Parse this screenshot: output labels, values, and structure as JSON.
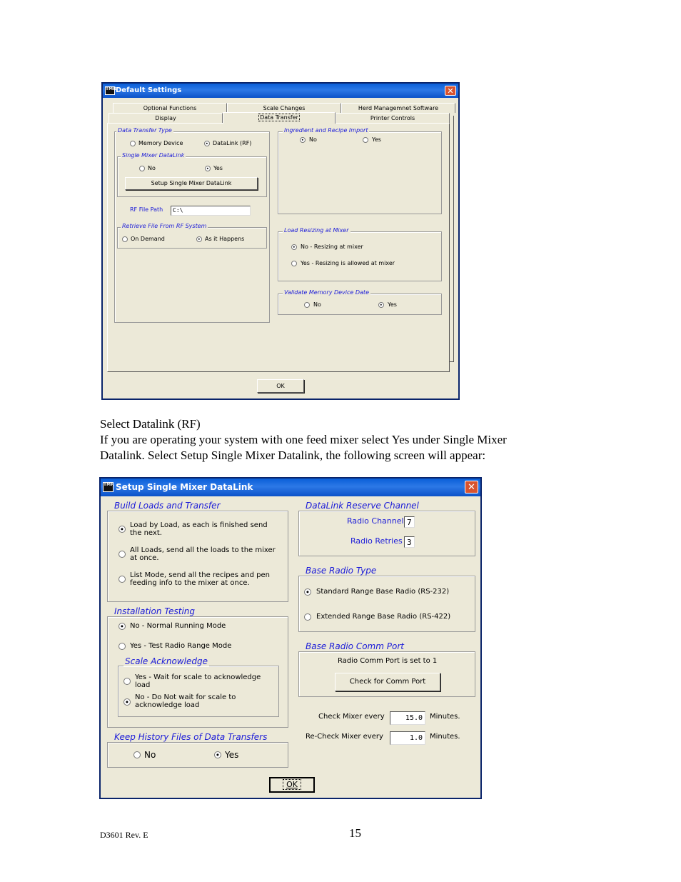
{
  "dialog1": {
    "title": "Default Settings",
    "title_icon": "TMR",
    "tabs_row1": [
      "Optional Functions",
      "Scale Changes",
      "Herd Managemnet Software"
    ],
    "tabs_row2": [
      "Display",
      "Data Transfer",
      "Printer Controls"
    ],
    "data_transfer_type": {
      "title": "Data Transfer Type",
      "options": [
        "Memory Device",
        "DataLink (RF)"
      ],
      "selected": "DataLink (RF)"
    },
    "single_mixer_datalink": {
      "title": "Single Mixer DataLink",
      "options": [
        "No",
        "Yes"
      ],
      "selected": "Yes",
      "setup_button": "Setup Single Mixer DataLink"
    },
    "rf_file_path": {
      "label": "RF File Path",
      "value": "C:\\"
    },
    "retrieve_file": {
      "title": "Retrieve File From RF System",
      "options": [
        "On Demand",
        "As it Happens"
      ],
      "selected": "As it Happens"
    },
    "ingredient_recipe_import": {
      "title": "Ingredient and Recipe Import",
      "options": [
        "No",
        "Yes"
      ],
      "selected": "No"
    },
    "load_resizing": {
      "title": "Load Resizing at Mixer",
      "options": [
        "No  - Resizing at mixer",
        "Yes -  Resizing is allowed at mixer"
      ],
      "selected": "No  - Resizing at mixer"
    },
    "validate_date": {
      "title": "Validate Memory Device Date",
      "options": [
        "No",
        "Yes"
      ],
      "selected": "Yes"
    },
    "ok_button": "OK"
  },
  "body_text": {
    "line1": "Select Datalink (RF)",
    "line2": "If you are operating your system with one feed mixer select Yes under Single Mixer",
    "line3": "Datalink.  Select Setup Single Mixer Datalink, the following screen will appear:"
  },
  "dialog2": {
    "title": "Setup Single Mixer DataLink",
    "title_icon": "TMR",
    "build_loads": {
      "title": "Build Loads and Transfer",
      "options": [
        [
          "Load by Load, as each is finished send",
          "the next."
        ],
        [
          "All Loads, send all the loads to the mixer",
          "at once."
        ],
        [
          "List Mode, send all the recipes and pen",
          "feeding info to the mixer at once."
        ]
      ],
      "selected_index": 0
    },
    "installation_testing": {
      "title": "Installation Testing",
      "options": [
        "No - Normal Running Mode",
        "Yes - Test Radio Range Mode"
      ],
      "selected_index": 0
    },
    "scale_ack": {
      "title": "Scale Acknowledge",
      "options": [
        [
          "Yes - Wait for scale to acknowledge",
          "load"
        ],
        [
          "No - Do Not wait for scale to",
          "acknowledge load"
        ]
      ],
      "selected_index": 1
    },
    "keep_history": {
      "title": "Keep History Files of Data Transfers",
      "options": [
        "No",
        "Yes"
      ],
      "selected_index": 1
    },
    "reserve_channel": {
      "title": "DataLink Reserve Channel",
      "radio_channel_label": "Radio Channel",
      "radio_channel_value": "7",
      "radio_retries_label": "Radio Retries",
      "radio_retries_value": "3"
    },
    "base_radio_type": {
      "title": "Base Radio Type",
      "options": [
        "Standard Range Base Radio (RS-232)",
        "Extended Range Base Radio (RS-422)"
      ],
      "selected_index": 0
    },
    "comm_port": {
      "title": "Base Radio Comm Port",
      "status": "Radio Comm Port is set to 1",
      "button": "Check for Comm Port"
    },
    "check_mixer": {
      "label": "Check Mixer every",
      "value": "15.0",
      "unit": "Minutes."
    },
    "recheck_mixer": {
      "label": "Re-Check Mixer every",
      "value": "1.0",
      "unit": "Minutes."
    },
    "ok_button": "OK"
  },
  "footer": {
    "doc_id": "D3601 Rev. E",
    "page_number": "15"
  }
}
